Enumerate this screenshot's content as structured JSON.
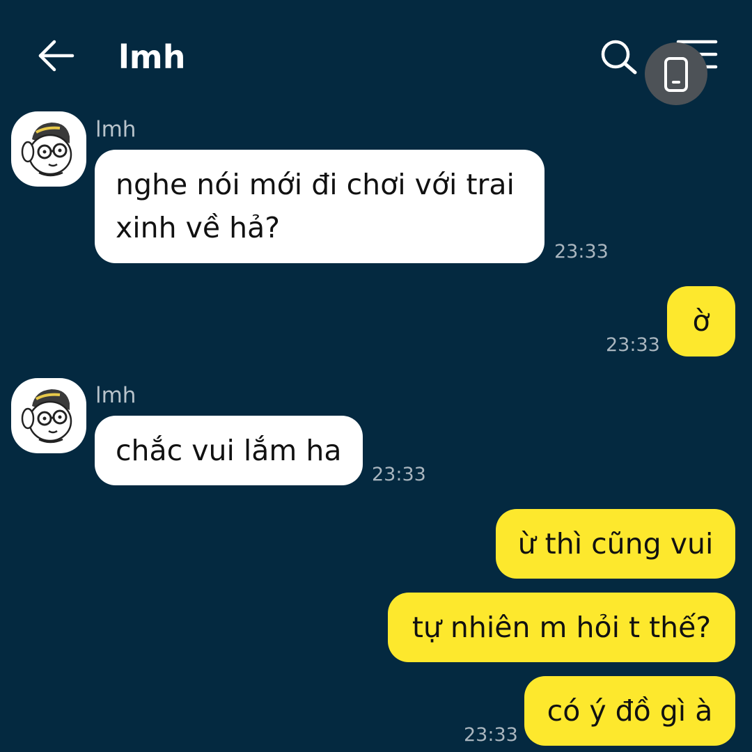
{
  "header": {
    "title": "lmh",
    "back_icon": "arrow-left-icon",
    "search_icon": "search-icon",
    "menu_icon": "menu-icon",
    "float_icon": "phone-icon"
  },
  "colors": {
    "background": "#042940",
    "incoming_bubble": "#ffffff",
    "outgoing_bubble": "#fde82d",
    "timestamp": "#aab6bf"
  },
  "messages": [
    {
      "direction": "incoming",
      "sender": "lmh",
      "text_lines": [
        "nghe nói mới đi chơi với trai",
        "xinh về hả?"
      ],
      "time": "23:33"
    },
    {
      "direction": "outgoing",
      "text": "ờ",
      "time": "23:33"
    },
    {
      "direction": "incoming",
      "sender": "lmh",
      "text": "chắc vui lắm ha",
      "time": "23:33"
    },
    {
      "direction": "outgoing",
      "text": "ừ thì cũng vui"
    },
    {
      "direction": "outgoing",
      "text": "tự nhiên m hỏi t thế?"
    },
    {
      "direction": "outgoing",
      "text": "có ý đồ gì à",
      "time": "23:33"
    }
  ]
}
